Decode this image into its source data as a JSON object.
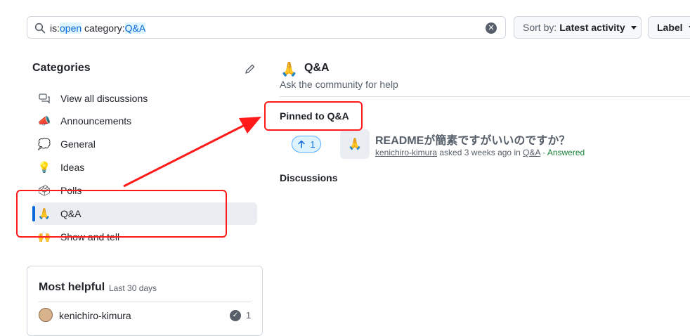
{
  "search": {
    "prefix_1": "is:",
    "value_1": "open",
    "prefix_2": " category:",
    "value_2": "Q&A",
    "clear_icon": "x-circle-icon"
  },
  "toolbar": {
    "sort_label": "Sort by:",
    "sort_value": "Latest activity",
    "label_button": "Label"
  },
  "sidebar": {
    "title": "Categories",
    "items": [
      {
        "emoji": "💬",
        "label": "View all discussions"
      },
      {
        "emoji": "📣",
        "label": "Announcements"
      },
      {
        "emoji": "💭",
        "label": "General"
      },
      {
        "emoji": "💡",
        "label": "Ideas"
      },
      {
        "emoji": "🗳",
        "label": "Polls"
      },
      {
        "emoji": "🙏",
        "label": "Q&A"
      },
      {
        "emoji": "🙌",
        "label": "Show and tell"
      }
    ],
    "active_index": 5
  },
  "most_helpful": {
    "title": "Most helpful",
    "period": "Last 30 days",
    "users": [
      {
        "name": "kenichiro-kimura",
        "count": "1"
      }
    ]
  },
  "category": {
    "emoji": "🙏",
    "title": "Q&A",
    "description": "Ask the community for help"
  },
  "pinned": {
    "heading": "Pinned to Q&A",
    "discussion": {
      "votes": "1",
      "emoji": "🙏",
      "title": "READMEが簡素ですがいいのですか？",
      "author": "kenichiro-kimura",
      "asked": "asked 3 weeks ago in",
      "category": "Q&A",
      "status": "· Answered"
    }
  },
  "discussions_heading": "Discussions",
  "colors": {
    "accent": "#0969da",
    "annotation": "#ff1a1a",
    "answered": "#1a7f37"
  }
}
